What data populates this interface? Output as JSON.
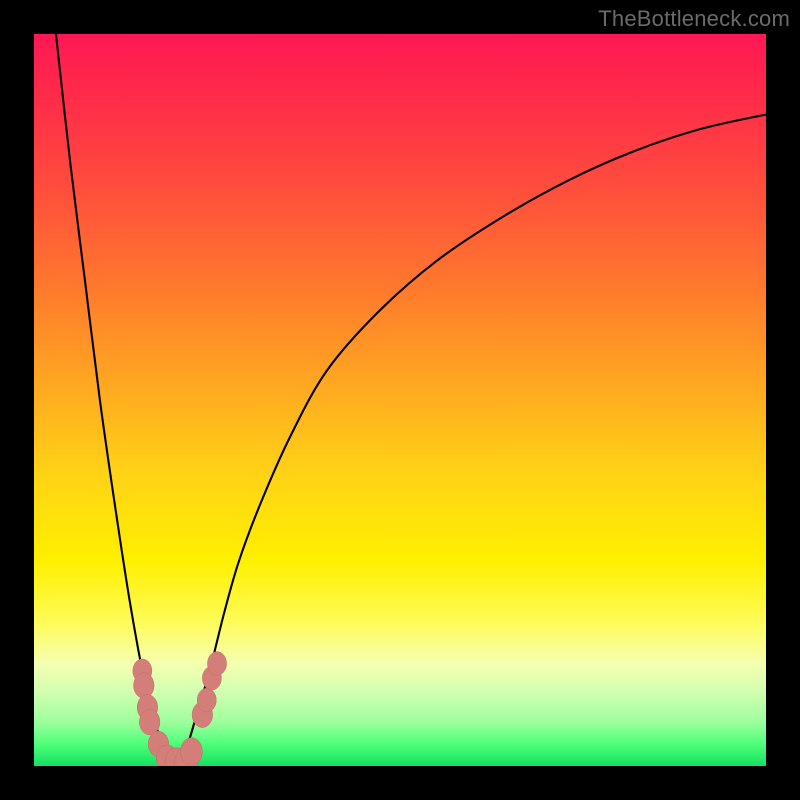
{
  "watermark": "TheBottleneck.com",
  "colors": {
    "frame": "#000000",
    "curve": "#000000",
    "marker_fill": "#d47e7a",
    "marker_stroke": "#c46a66"
  },
  "chart_data": {
    "type": "line",
    "title": "",
    "xlabel": "",
    "ylabel": "",
    "xlim": [
      0,
      100
    ],
    "ylim": [
      0,
      100
    ],
    "grid": false,
    "legend": false,
    "series": [
      {
        "name": "left-branch",
        "x": [
          3,
          5,
          7,
          9,
          11,
          13,
          15,
          16.5,
          18,
          19.5
        ],
        "y": [
          100,
          82,
          66,
          50,
          36,
          23,
          12,
          6,
          2,
          0
        ]
      },
      {
        "name": "right-branch",
        "x": [
          19.5,
          21,
          22.5,
          24,
          26,
          28,
          31,
          35,
          40,
          47,
          55,
          64,
          73,
          82,
          91,
          100
        ],
        "y": [
          0,
          3,
          8,
          13,
          21,
          28,
          36,
          45,
          54,
          62,
          69,
          75,
          80,
          84,
          87,
          89
        ]
      }
    ],
    "markers": [
      {
        "x": 14.8,
        "y": 13,
        "r": 1.3
      },
      {
        "x": 15.0,
        "y": 11,
        "r": 1.4
      },
      {
        "x": 15.5,
        "y": 8,
        "r": 1.4
      },
      {
        "x": 15.8,
        "y": 6,
        "r": 1.4
      },
      {
        "x": 17.0,
        "y": 3,
        "r": 1.4
      },
      {
        "x": 18.2,
        "y": 1,
        "r": 1.5
      },
      {
        "x": 19.5,
        "y": 0.5,
        "r": 1.6
      },
      {
        "x": 20.8,
        "y": 0.5,
        "r": 1.6
      },
      {
        "x": 21.5,
        "y": 2,
        "r": 1.5
      },
      {
        "x": 23.0,
        "y": 7,
        "r": 1.4
      },
      {
        "x": 23.6,
        "y": 9,
        "r": 1.3
      },
      {
        "x": 24.3,
        "y": 12,
        "r": 1.3
      },
      {
        "x": 25.0,
        "y": 14,
        "r": 1.3
      }
    ]
  }
}
